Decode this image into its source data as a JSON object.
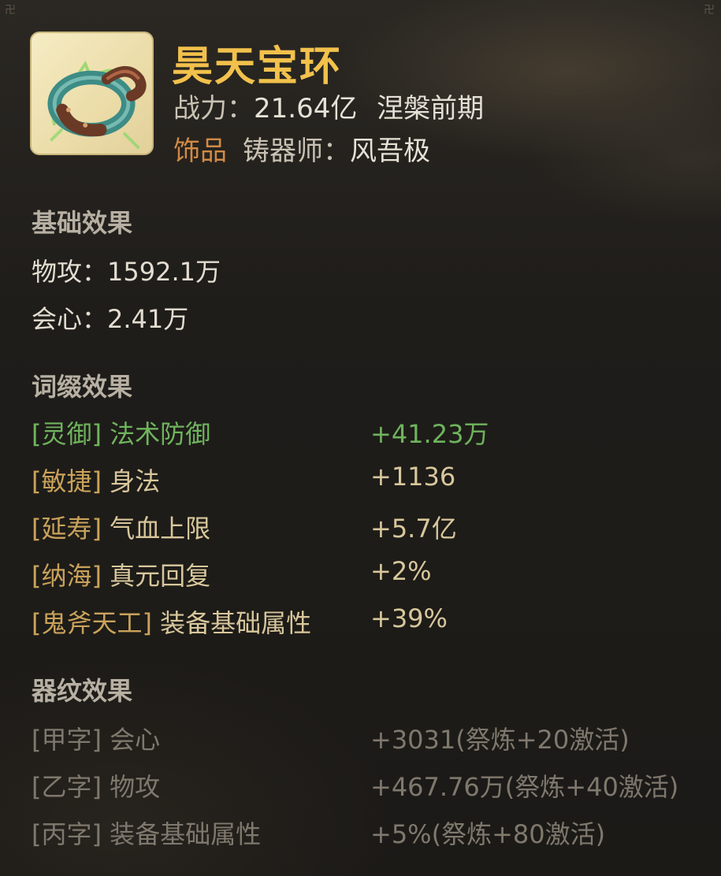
{
  "item": {
    "name": "昊天宝环",
    "power_label": "战力：",
    "power_value": "21.64亿",
    "realm": "涅槃前期",
    "type": "饰品",
    "crafter_label": "铸器师：",
    "crafter_name": "风吾极",
    "icon": "jade-ring-icon"
  },
  "base": {
    "heading": "基础效果",
    "stats": [
      {
        "label": "物攻：",
        "value": "1592.1万"
      },
      {
        "label": "会心：",
        "value": "2.41万"
      }
    ]
  },
  "affix": {
    "heading": "词缀效果",
    "items": [
      {
        "tag": "[灵御]",
        "name": "法术防御",
        "value": "+41.23万"
      },
      {
        "tag": "[敏捷]",
        "name": "身法",
        "value": "+1136"
      },
      {
        "tag": "[延寿]",
        "name": "气血上限",
        "value": "+5.7亿"
      },
      {
        "tag": "[纳海]",
        "name": "真元回复",
        "value": "+2%"
      },
      {
        "tag": "[鬼斧天工]",
        "name": "装备基础属性",
        "value": "+39%"
      }
    ]
  },
  "grain": {
    "heading": "器纹效果",
    "items": [
      {
        "tag": "[甲字]",
        "name": "会心",
        "value": "+3031(祭炼+20激活)"
      },
      {
        "tag": "[乙字]",
        "name": "物攻",
        "value": "+467.76万(祭炼+40激活)"
      },
      {
        "tag": "[丙字]",
        "name": "装备基础属性",
        "value": "+5%(祭炼+80激活)"
      }
    ]
  },
  "colors": {
    "title": "#f2c14c",
    "type": "#d18a44",
    "green": "#6fb45d",
    "affix": "#d8c79c",
    "grain": "#7f786d"
  }
}
